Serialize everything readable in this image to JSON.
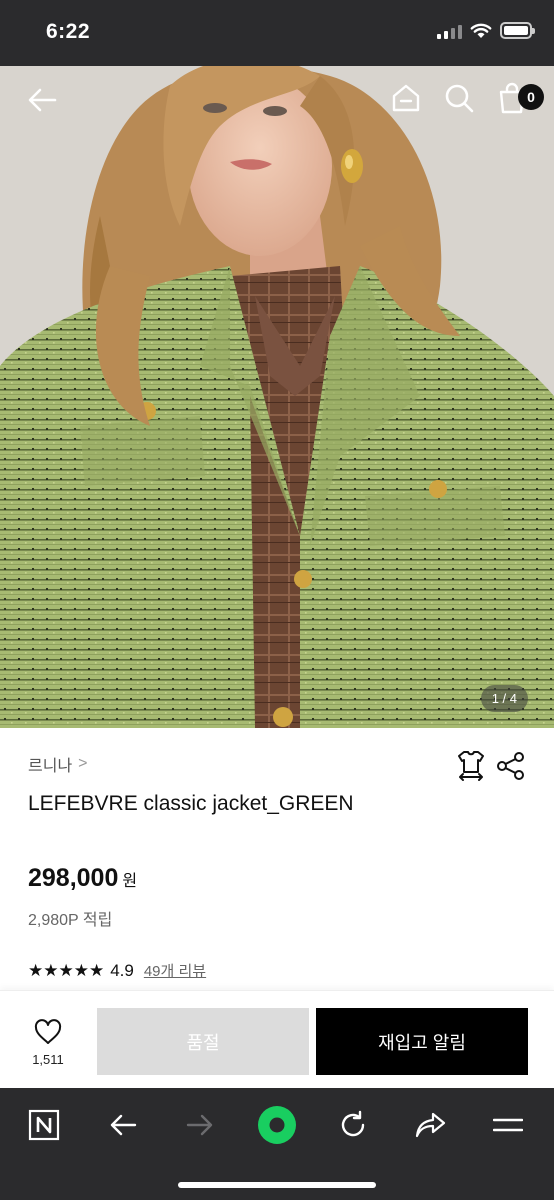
{
  "status_bar": {
    "time": "6:22"
  },
  "hero": {
    "counter": "1 / 4",
    "cart_count": "0",
    "icons": [
      "back-arrow-icon",
      "home-icon",
      "search-icon",
      "shopping-bag-icon"
    ]
  },
  "product": {
    "brand": "르니나",
    "brand_chevron": ">",
    "name": "LEFEBVRE classic jacket_GREEN",
    "price": "298,000",
    "price_unit": "원",
    "points": "2,980P 적립",
    "stars": "★★★★★",
    "rating": "4.9",
    "reviews": "49개 리뷰",
    "icons": [
      "size-guide-icon",
      "share-icon"
    ]
  },
  "purchase": {
    "like_count": "1,511",
    "soldout_label": "품절",
    "restock_label": "재입고 알림"
  },
  "browser": {
    "icons": [
      "naver-icon",
      "back-icon",
      "forward-icon",
      "green-dot-icon",
      "refresh-icon",
      "share-icon",
      "menu-icon"
    ]
  },
  "colors": {
    "status_bar": "#2b2b2d",
    "accent_green": "#19ce60",
    "jacket_green": "#a5b870",
    "button_disabled": "#dcdcdc",
    "button_primary": "#000000"
  }
}
